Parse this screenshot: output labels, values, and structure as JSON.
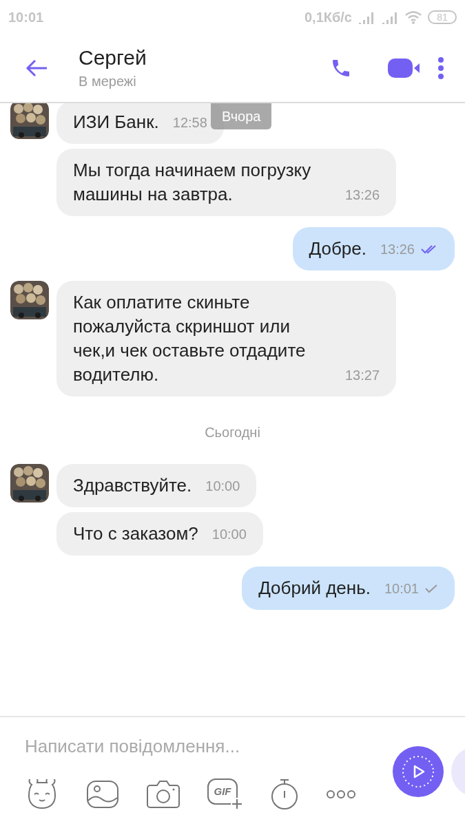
{
  "status_bar": {
    "time": "10:01",
    "speed": "0,1Кб/с",
    "battery": "81"
  },
  "header": {
    "name": "Сергей",
    "status": "В мережі"
  },
  "floating_date": "Вчора",
  "messages": [
    {
      "kind": "incoming",
      "avatar": true,
      "text": "ИЗИ Банк.",
      "time": "12:58"
    },
    {
      "kind": "incoming",
      "avatar": false,
      "text": "Мы тогда начинаем погрузку машины на завтра.",
      "time": "13:26"
    },
    {
      "kind": "outgoing",
      "text": "Добре.",
      "time": "13:26",
      "read": true
    },
    {
      "kind": "incoming",
      "avatar": true,
      "text": "Как оплатите скиньте пожалуйста скриншот или чек,и чек оставьте отдадите водителю.",
      "time": "13:27"
    },
    {
      "kind": "date",
      "text": "Сьогодні"
    },
    {
      "kind": "incoming",
      "avatar": true,
      "text": "Здравствуйте.",
      "time": "10:00"
    },
    {
      "kind": "incoming",
      "avatar": false,
      "text": "Что с заказом?",
      "time": "10:00"
    },
    {
      "kind": "outgoing",
      "text": "Добрий день.",
      "time": "10:01",
      "read": false
    }
  ],
  "composer": {
    "placeholder": "Написати повідомлення..."
  },
  "toolbar": [
    {
      "kind": "sticker"
    },
    {
      "kind": "gallery"
    },
    {
      "kind": "camera"
    },
    {
      "kind": "gif",
      "text": "GIF"
    },
    {
      "kind": "timer"
    },
    {
      "kind": "more"
    }
  ]
}
